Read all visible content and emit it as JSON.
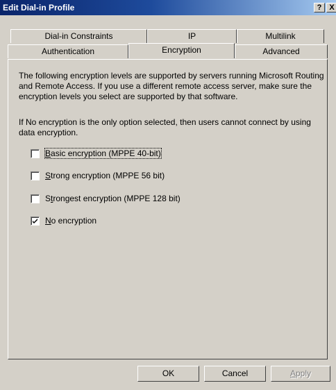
{
  "window": {
    "title": "Edit Dial-in Profile",
    "help_glyph": "?",
    "close_glyph": "X"
  },
  "tabs": {
    "back_row": [
      "Dial-in Constraints",
      "IP",
      "Multilink"
    ],
    "front_row": [
      "Authentication",
      "Encryption",
      "Advanced"
    ],
    "selected": "Encryption"
  },
  "panel": {
    "intro": "The following encryption levels are supported by servers running Microsoft Routing and Remote Access. If you use a different remote access server, make sure the encryption levels you select are supported by that software.",
    "note": "If No encryption is the only option selected, then users cannot connect by using data encryption."
  },
  "options": [
    {
      "accel": "B",
      "rest": "asic encryption (MPPE 40-bit)",
      "checked": false
    },
    {
      "accel": "S",
      "rest": "trong encryption (MPPE 56 bit)",
      "checked": false
    },
    {
      "pre": "S",
      "accel": "t",
      "rest": "rongest encryption (MPPE 128 bit)",
      "checked": false
    },
    {
      "accel": "N",
      "rest": "o encryption",
      "checked": true
    }
  ],
  "buttons": {
    "ok": "OK",
    "cancel": "Cancel",
    "apply_accel": "A",
    "apply_rest": "pply"
  },
  "colors": {
    "face": "#d4d0c8",
    "title_start": "#0a246a",
    "title_end": "#a6caf0"
  }
}
